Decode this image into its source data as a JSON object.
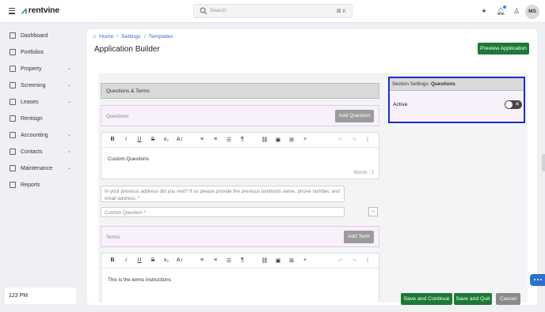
{
  "app": {
    "brand": "rentvine"
  },
  "search": {
    "placeholder": "Search",
    "shortcut": "⌘ K"
  },
  "user": {
    "initials": "MS"
  },
  "sidebar": {
    "items": [
      {
        "label": "Dashboard",
        "icon": "dashboard-icon",
        "has_chevron": false
      },
      {
        "label": "Portfolios",
        "icon": "folder-icon",
        "has_chevron": false
      },
      {
        "label": "Property",
        "icon": "building-icon",
        "has_chevron": true
      },
      {
        "label": "Screening",
        "icon": "screening-icon",
        "has_chevron": true
      },
      {
        "label": "Leases",
        "icon": "lease-icon",
        "has_chevron": true
      },
      {
        "label": "Rentsign",
        "icon": "signature-icon",
        "has_chevron": false
      },
      {
        "label": "Accounting",
        "icon": "dollar-icon",
        "has_chevron": true
      },
      {
        "label": "Contacts",
        "icon": "contacts-icon",
        "has_chevron": true
      },
      {
        "label": "Maintenance",
        "icon": "wrench-icon",
        "has_chevron": true
      },
      {
        "label": "Reports",
        "icon": "chart-icon",
        "has_chevron": false
      }
    ],
    "time": "123 PM"
  },
  "breadcrumb": {
    "home": "Home",
    "settings": "Settings",
    "templates": "Templates"
  },
  "page": {
    "title": "Application Builder",
    "preview_label": "Preview Application"
  },
  "builder": {
    "section_header": "Questions & Terms",
    "questions_label": "Questions",
    "add_question_label": "Add Question",
    "questions_editor_content": "Custom Questions",
    "word_count": "Words : 2",
    "address_question": "In your previous address did you rent? If so please provide the previous landlords name, phone number, and email address. *",
    "custom_question_placeholder": "Custom Question *",
    "terms_label": "Terms",
    "add_term_label": "Add Term",
    "terms_editor_content": "This is the terms instructions"
  },
  "settings_panel": {
    "prefix": "Section Settings:",
    "section": "Questions",
    "active_label": "Active",
    "active": false
  },
  "actions": {
    "save_continue": "Save and Continue",
    "save_quit": "Save and Quit",
    "cancel": "Cancel"
  },
  "colors": {
    "primary_green": "#1c7a35",
    "highlight_border": "#1a2dc4",
    "link_blue": "#2f6fd0"
  }
}
